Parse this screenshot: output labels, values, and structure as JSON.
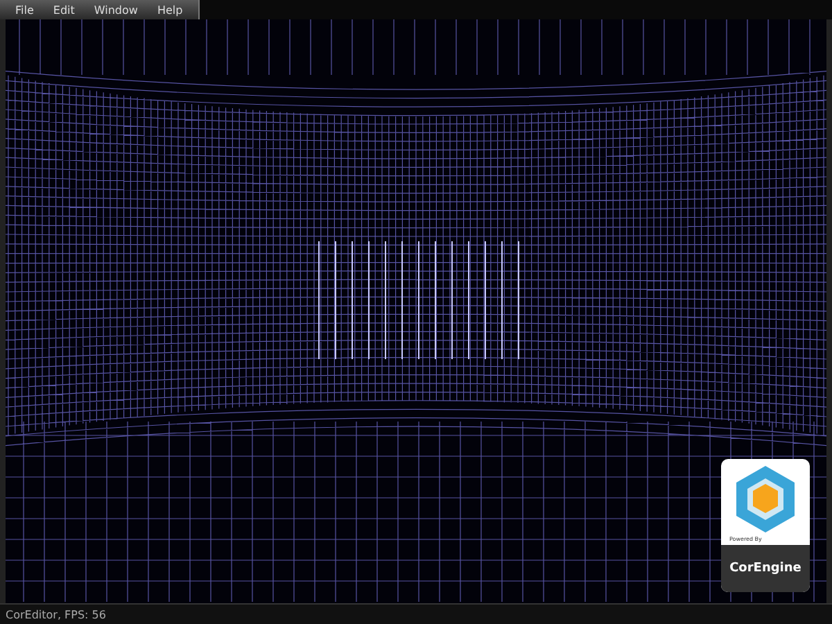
{
  "menu_bar": {
    "items": [
      "File",
      "Edit",
      "Window",
      "Help"
    ]
  },
  "badge": {
    "caption": "Powered By",
    "name": "CorEngine"
  },
  "status_bar": {
    "text": "CorEditor, FPS: 56"
  }
}
